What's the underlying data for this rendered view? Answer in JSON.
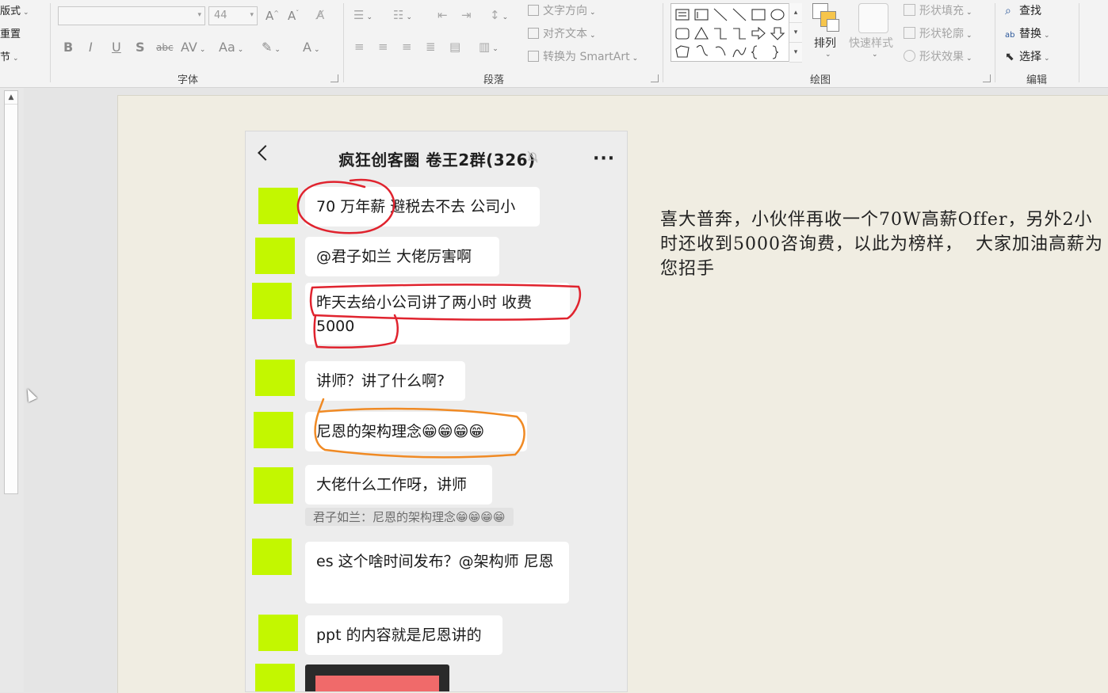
{
  "ribbon": {
    "slides_group": {
      "layout": "版式",
      "reset": "重置",
      "section": "节"
    },
    "font_group": {
      "label": "字体",
      "font_name": "",
      "font_size": "44",
      "buttons": [
        "B",
        "I",
        "U",
        "S",
        "abc",
        "AV",
        "Aa",
        "A"
      ]
    },
    "paragraph_group": {
      "label": "段落",
      "text_direction": "文字方向",
      "align_text": "对齐文本",
      "convert_smartart": "转换为 SmartArt"
    },
    "drawing_group": {
      "label": "绘图",
      "arrange": "排列",
      "quick_styles": "快速样式",
      "shape_fill": "形状填充",
      "shape_outline": "形状轮廓",
      "shape_effects": "形状效果"
    },
    "editing_group": {
      "label": "编辑",
      "find": "查找",
      "replace": "替换",
      "select": "选择"
    }
  },
  "chat": {
    "title": "疯狂创客圈 卷王2群(326)",
    "messages": [
      {
        "text": "70 万年薪 避税去不去 公司小"
      },
      {
        "text": "@君子如兰  大佬厉害啊"
      },
      {
        "text": "昨天去给小公司讲了两小时 收费 5000"
      },
      {
        "text": "讲师？讲了什么啊?"
      },
      {
        "text": "尼恩的架构理念😁😁😁😁"
      },
      {
        "text": "大佬什么工作呀，讲师"
      },
      {
        "text": "es 这个啥时间发布？@架构师 尼恩"
      },
      {
        "text": "ppt 的内容就是尼恩讲的"
      }
    ],
    "quote": "君子如兰：尼恩的架构理念😁😁😁😁"
  },
  "slide": {
    "text": "喜大普奔，小伙伴再收一个70W高薪Offer，另外2小时还收到5000咨询费，以此为榜样，  大家加油高薪为您招手"
  },
  "colors": {
    "avatar": "#c3f700",
    "red_circle": "#e0232e",
    "orange_circle": "#f08a24",
    "slide_bg": "#f0ede2"
  }
}
